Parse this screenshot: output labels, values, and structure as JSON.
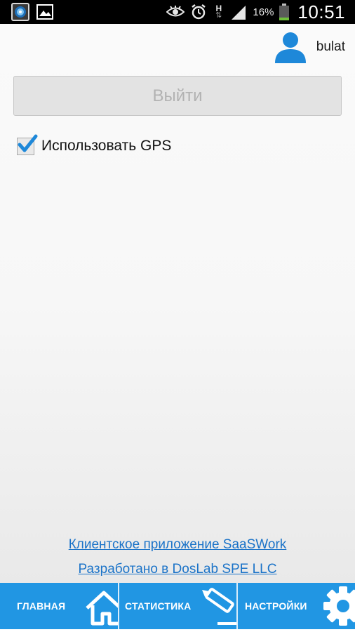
{
  "status_bar": {
    "battery_percent": "16%",
    "time": "10:51",
    "network_label": "H",
    "icons": [
      "app-notification-icon",
      "image-notification-icon",
      "eye-icon",
      "alarm-icon",
      "data-transfer-icon",
      "signal-icon",
      "battery-icon"
    ]
  },
  "user": {
    "name": "bulat",
    "icon": "user-avatar-icon"
  },
  "logout_button": {
    "label": "Выйти"
  },
  "gps": {
    "label": "Использовать GPS",
    "checked": true
  },
  "footer_links": {
    "client_app": "Клиентское приложение SaaSWork",
    "developed_by": "Разработано в DosLab SPE LLC"
  },
  "bottom_nav": {
    "home": {
      "label": "ГЛАВНАЯ",
      "icon": "home-icon"
    },
    "stats": {
      "label": "СТАТИСТИКА",
      "icon": "pencil-icon"
    },
    "settings": {
      "label": "НАСТРОЙКИ",
      "icon": "gear-icon"
    }
  },
  "colors": {
    "accent": "#2196e3",
    "link": "#1b73c8",
    "checkbox_check": "#1e88d9"
  }
}
